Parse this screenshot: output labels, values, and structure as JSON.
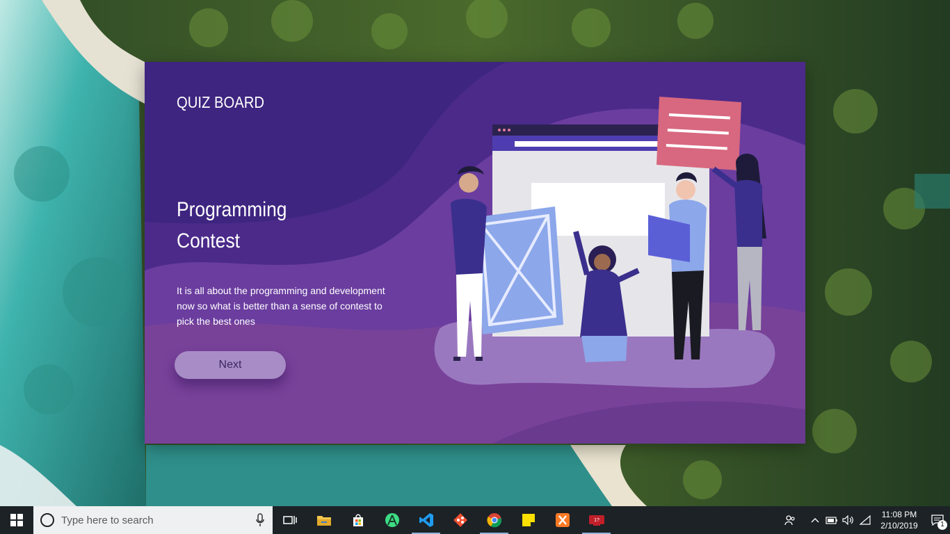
{
  "app": {
    "brand": "QUIZ BOARD",
    "headline_line1": "Programming",
    "headline_line2": "Contest",
    "description": "It is all about the programming and development now so what is better than a sense of contest to pick the best ones",
    "next_label": "Next"
  },
  "taskbar": {
    "search_placeholder": "Type here to search",
    "pinned_icons": [
      "task-view-icon",
      "file-explorer-icon",
      "microsoft-store-icon",
      "android-studio-icon",
      "vscode-icon",
      "git-icon",
      "chrome-icon",
      "sticky-notes-icon",
      "xampp-icon",
      "app-red-icon"
    ],
    "time": "11:08 PM",
    "date": "2/10/2019",
    "notification_count": "1"
  },
  "colors": {
    "window_purple": "#5c3496",
    "button": "#a88cc6",
    "taskbar": "#1c2226"
  }
}
